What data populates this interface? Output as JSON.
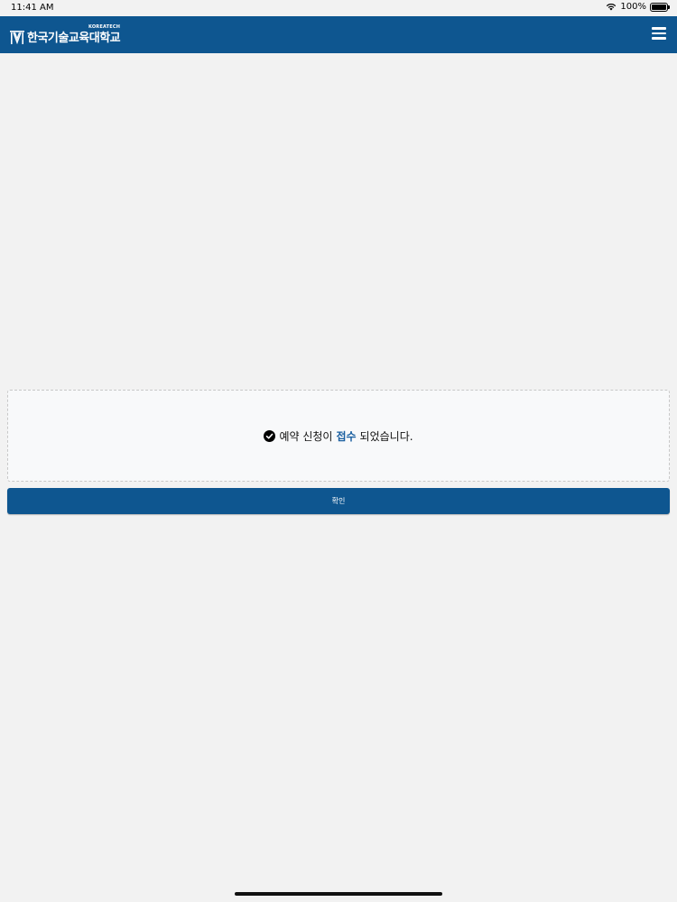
{
  "status_bar": {
    "time": "11:41 AM",
    "battery_text": "100%",
    "battery_level": 1.0
  },
  "header": {
    "logo_main": "한국기술교육대학교",
    "logo_sub": "KOREATECH",
    "background_color": "#0e5690",
    "menu_icon": "hamburger-menu-icon"
  },
  "result": {
    "icon": "check-circle-icon",
    "message_before": "예약 신청이",
    "message_highlight": "접수",
    "message_after": "되었습니다.",
    "highlight_color": "#1a5fa0"
  },
  "confirm_button": {
    "label": "확인"
  }
}
